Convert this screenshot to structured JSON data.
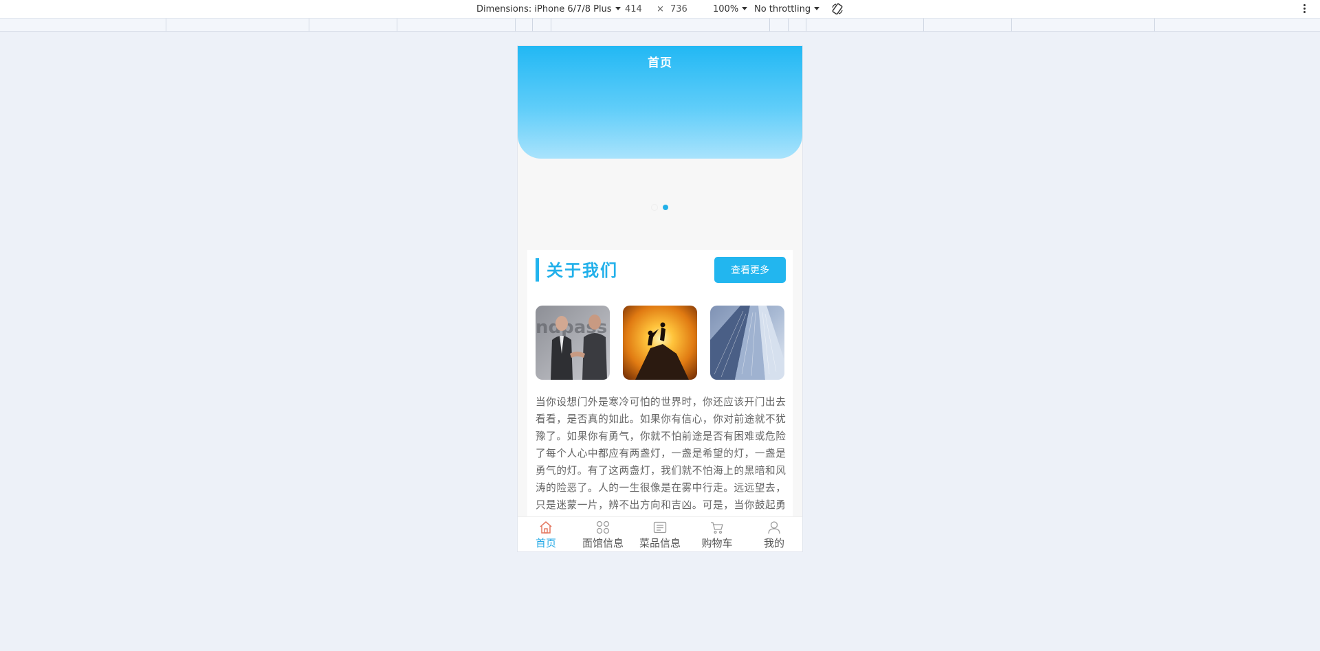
{
  "devtools": {
    "dimensions_label": "Dimensions: iPhone 6/7/8 Plus",
    "width": "414",
    "times": "×",
    "height": "736",
    "zoom": "100%",
    "throttling": "No throttling"
  },
  "header": {
    "title": "首页"
  },
  "carousel": {
    "slide_count": 2,
    "active_index": 1
  },
  "about": {
    "title": "关于我们",
    "more_label": "查看更多",
    "images": [
      "business-handshake-photo",
      "mountain-sunset-climb-photo",
      "glass-skyscraper-photo"
    ],
    "text": "当你设想门外是寒冷可怕的世界时，你还应该开门出去看看，是否真的如此。如果你有信心，你对前途就不犹豫了。如果你有勇气，你就不怕前途是否有困难或危险了每个人心中都应有两盏灯，一盏是希望的灯，一盏是勇气的灯。有了这两盏灯，我们就不怕海上的黑暗和风涛的险恶了。人的一生很像是在雾中行走。远远望去，只是迷蒙一片，辨不出方向和吉凶。可是，当你鼓起勇气，放下畏惧和怀疑，一步一步向前走去的时候，你就会发现"
  },
  "tabbar": {
    "items": [
      {
        "label": "首页",
        "icon": "home-icon",
        "active": true
      },
      {
        "label": "面馆信息",
        "icon": "grid-icon",
        "active": false
      },
      {
        "label": "菜品信息",
        "icon": "news-icon",
        "active": false
      },
      {
        "label": "购物车",
        "icon": "cart-icon",
        "active": false
      },
      {
        "label": "我的",
        "icon": "user-icon",
        "active": false
      }
    ]
  },
  "colors": {
    "accent": "#22b4ee",
    "hero_top": "#22b8f4",
    "hero_bottom": "#a9e3fc",
    "active_tab_icon": "#e4765e",
    "page_bg": "#edf1f8"
  }
}
